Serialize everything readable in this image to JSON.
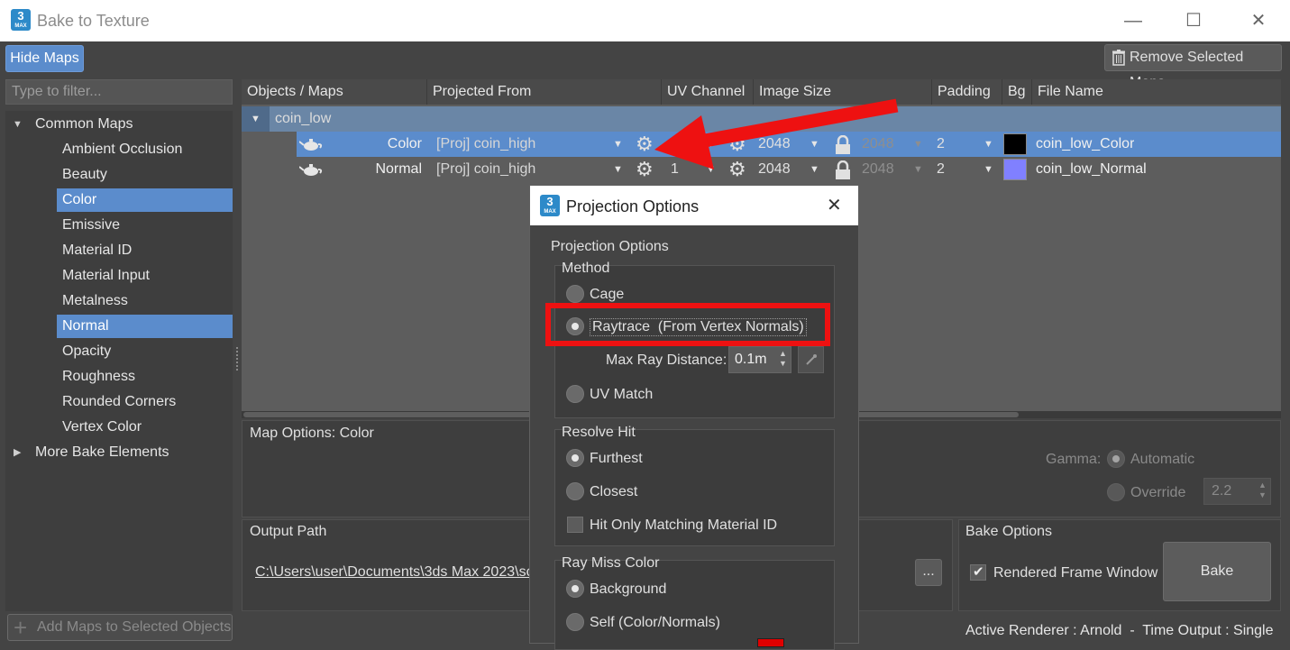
{
  "window": {
    "title": "Bake to Texture",
    "app_icon_number": "3",
    "app_icon_caption": "MAX",
    "controls": {
      "minimize": "—",
      "maximize": "☐",
      "close": "✕"
    }
  },
  "toolbar": {
    "hide_maps": "Hide Maps",
    "remove_selected_maps": "Remove Selected Maps"
  },
  "left": {
    "filter_placeholder": "Type to filter...",
    "group_common": "Common Maps",
    "items": [
      {
        "label": "Ambient Occlusion",
        "selected": false
      },
      {
        "label": "Beauty",
        "selected": false
      },
      {
        "label": "Color",
        "selected": true
      },
      {
        "label": "Emissive",
        "selected": false
      },
      {
        "label": "Material ID",
        "selected": false
      },
      {
        "label": "Material Input",
        "selected": false
      },
      {
        "label": "Metalness",
        "selected": false
      },
      {
        "label": "Normal",
        "selected": true
      },
      {
        "label": "Opacity",
        "selected": false
      },
      {
        "label": "Roughness",
        "selected": false
      },
      {
        "label": "Rounded Corners",
        "selected": false
      },
      {
        "label": "Vertex Color",
        "selected": false
      }
    ],
    "group_more": "More Bake Elements",
    "add_maps": "Add Maps to Selected Objects"
  },
  "grid": {
    "columns": {
      "objects": "Objects / Maps",
      "projected": "Projected From",
      "uv": "UV Channel",
      "image": "Image Size",
      "padding": "Padding",
      "bg": "Bg",
      "file": "File Name"
    },
    "object_name": "coin_low",
    "rows": [
      {
        "map": "Color",
        "projected": "[Proj] coin_high",
        "uv": "",
        "size": "2048",
        "size_locked": "2048",
        "padding": "2",
        "bg": "#000000",
        "file": "coin_low_Color"
      },
      {
        "map": "Normal",
        "projected": "[Proj] coin_high",
        "uv": "1",
        "size": "2048",
        "size_locked": "2048",
        "padding": "2",
        "bg": "#8080ff",
        "file": "coin_low_Normal"
      }
    ]
  },
  "map_options": {
    "title": "Map Options: Color",
    "gamma_label": "Gamma:",
    "gamma_auto": "Automatic",
    "gamma_override": "Override",
    "gamma_value": "2.2"
  },
  "output": {
    "title": "Output Path",
    "path": "C:\\Users\\user\\Documents\\3ds Max 2023\\sc",
    "browse": "..."
  },
  "bake_options": {
    "title": "Bake Options",
    "rendered_frame_window": "Rendered Frame Window",
    "bake": "Bake"
  },
  "status": "Active Renderer : Arnold  -  Time Output : Single",
  "dialog": {
    "title": "Projection Options",
    "section_title": "Projection Options",
    "method_title": "Method",
    "cage": "Cage",
    "raytrace": "Raytrace  (From Vertex Normals)",
    "max_ray_label": "Max Ray Distance:",
    "max_ray_value": "0.1m",
    "uv_match": "UV Match",
    "resolve_title": "Resolve Hit",
    "furthest": "Furthest",
    "closest": "Closest",
    "hit_only": "Hit Only Matching Material ID",
    "ray_miss_title": "Ray Miss Color",
    "background": "Background",
    "self": "Self (Color/Normals)",
    "miss_color": "#e00000"
  },
  "annotation_color": "#ee1111"
}
